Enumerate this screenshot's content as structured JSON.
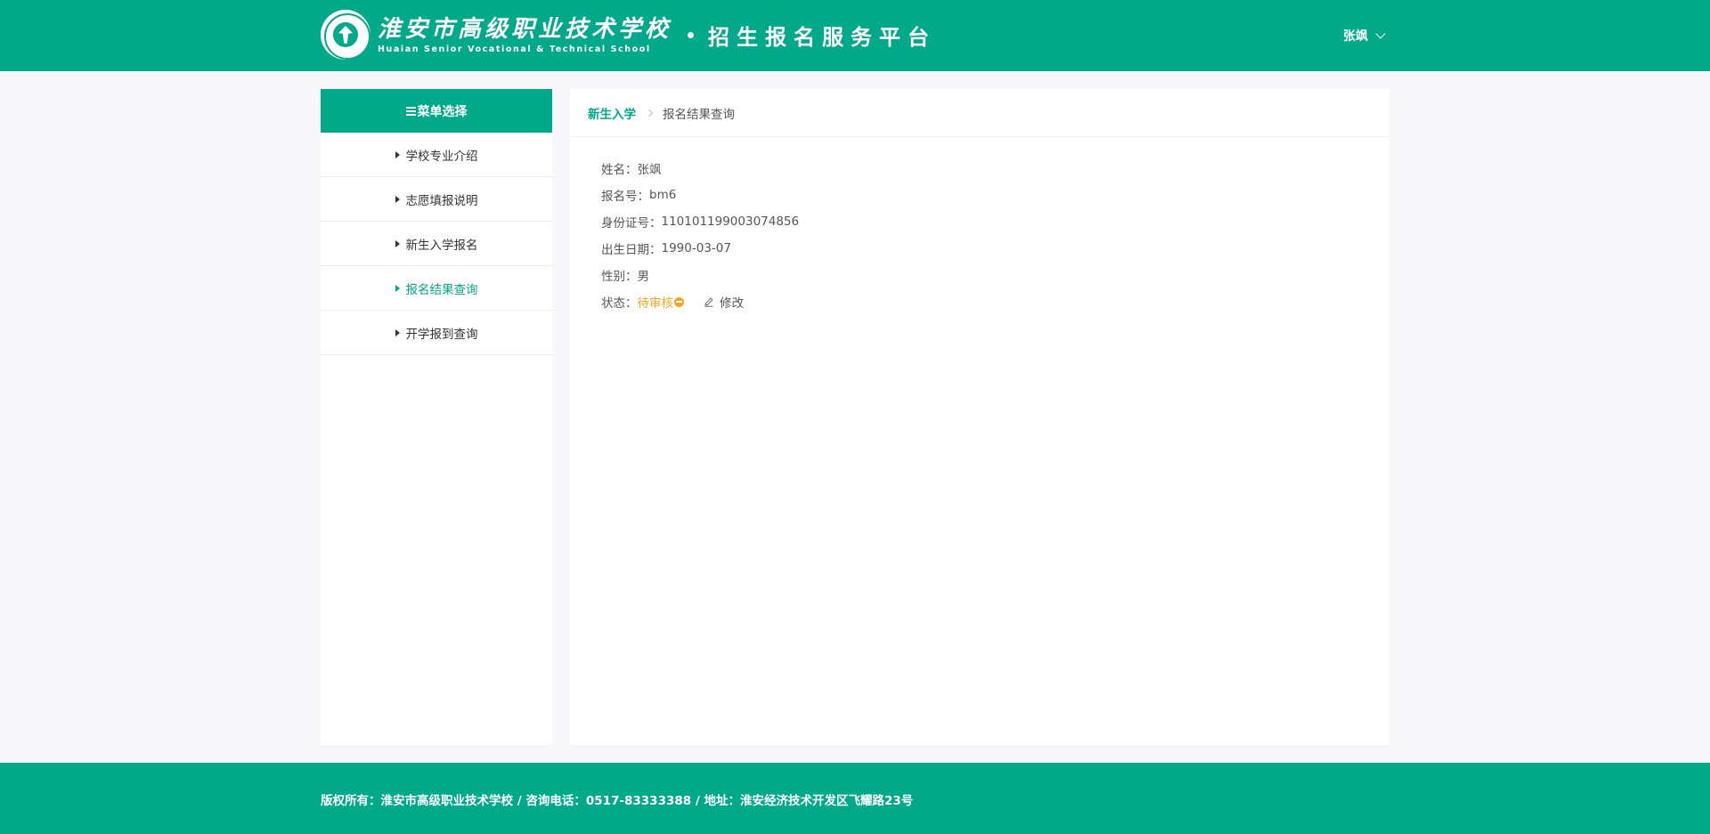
{
  "header": {
    "school_name_cn": "淮安市高级职业技术学校",
    "school_name_en": "Huaian Senior Vocational & Technical School",
    "platform_name": "招生报名服务平台",
    "user_name": "张飒"
  },
  "sidebar": {
    "title": "菜单选择",
    "items": [
      {
        "label": "学校专业介绍",
        "active": false
      },
      {
        "label": "志愿填报说明",
        "active": false
      },
      {
        "label": "新生入学报名",
        "active": false
      },
      {
        "label": "报名结果查询",
        "active": true
      },
      {
        "label": "开学报到查询",
        "active": false
      }
    ]
  },
  "breadcrumb": {
    "parent": "新生入学",
    "current": "报名结果查询"
  },
  "info": {
    "name_label": "姓名：",
    "name_value": "张飒",
    "reg_label": "报名号：",
    "reg_value": "bm6",
    "id_label": "身份证号：",
    "id_value": "110101199003074856",
    "birth_label": "出生日期：",
    "birth_value": "1990-03-07",
    "gender_label": "性别：",
    "gender_value": "男",
    "status_label": "状态：",
    "status_value": "待审核",
    "edit_label": "修改"
  },
  "footer": {
    "text": "版权所有：淮安市高级职业技术学校 / 咨询电话：0517-83333388 / 地址：淮安经济技术开发区飞耀路23号"
  },
  "colors": {
    "brand": "#00a98a",
    "status_pending": "#f5a623"
  },
  "icons": [
    "school-seal-logo",
    "chevron-down-icon",
    "grid-icon",
    "triangle-right-icon",
    "chevron-right-icon",
    "pending-icon",
    "edit-icon"
  ]
}
